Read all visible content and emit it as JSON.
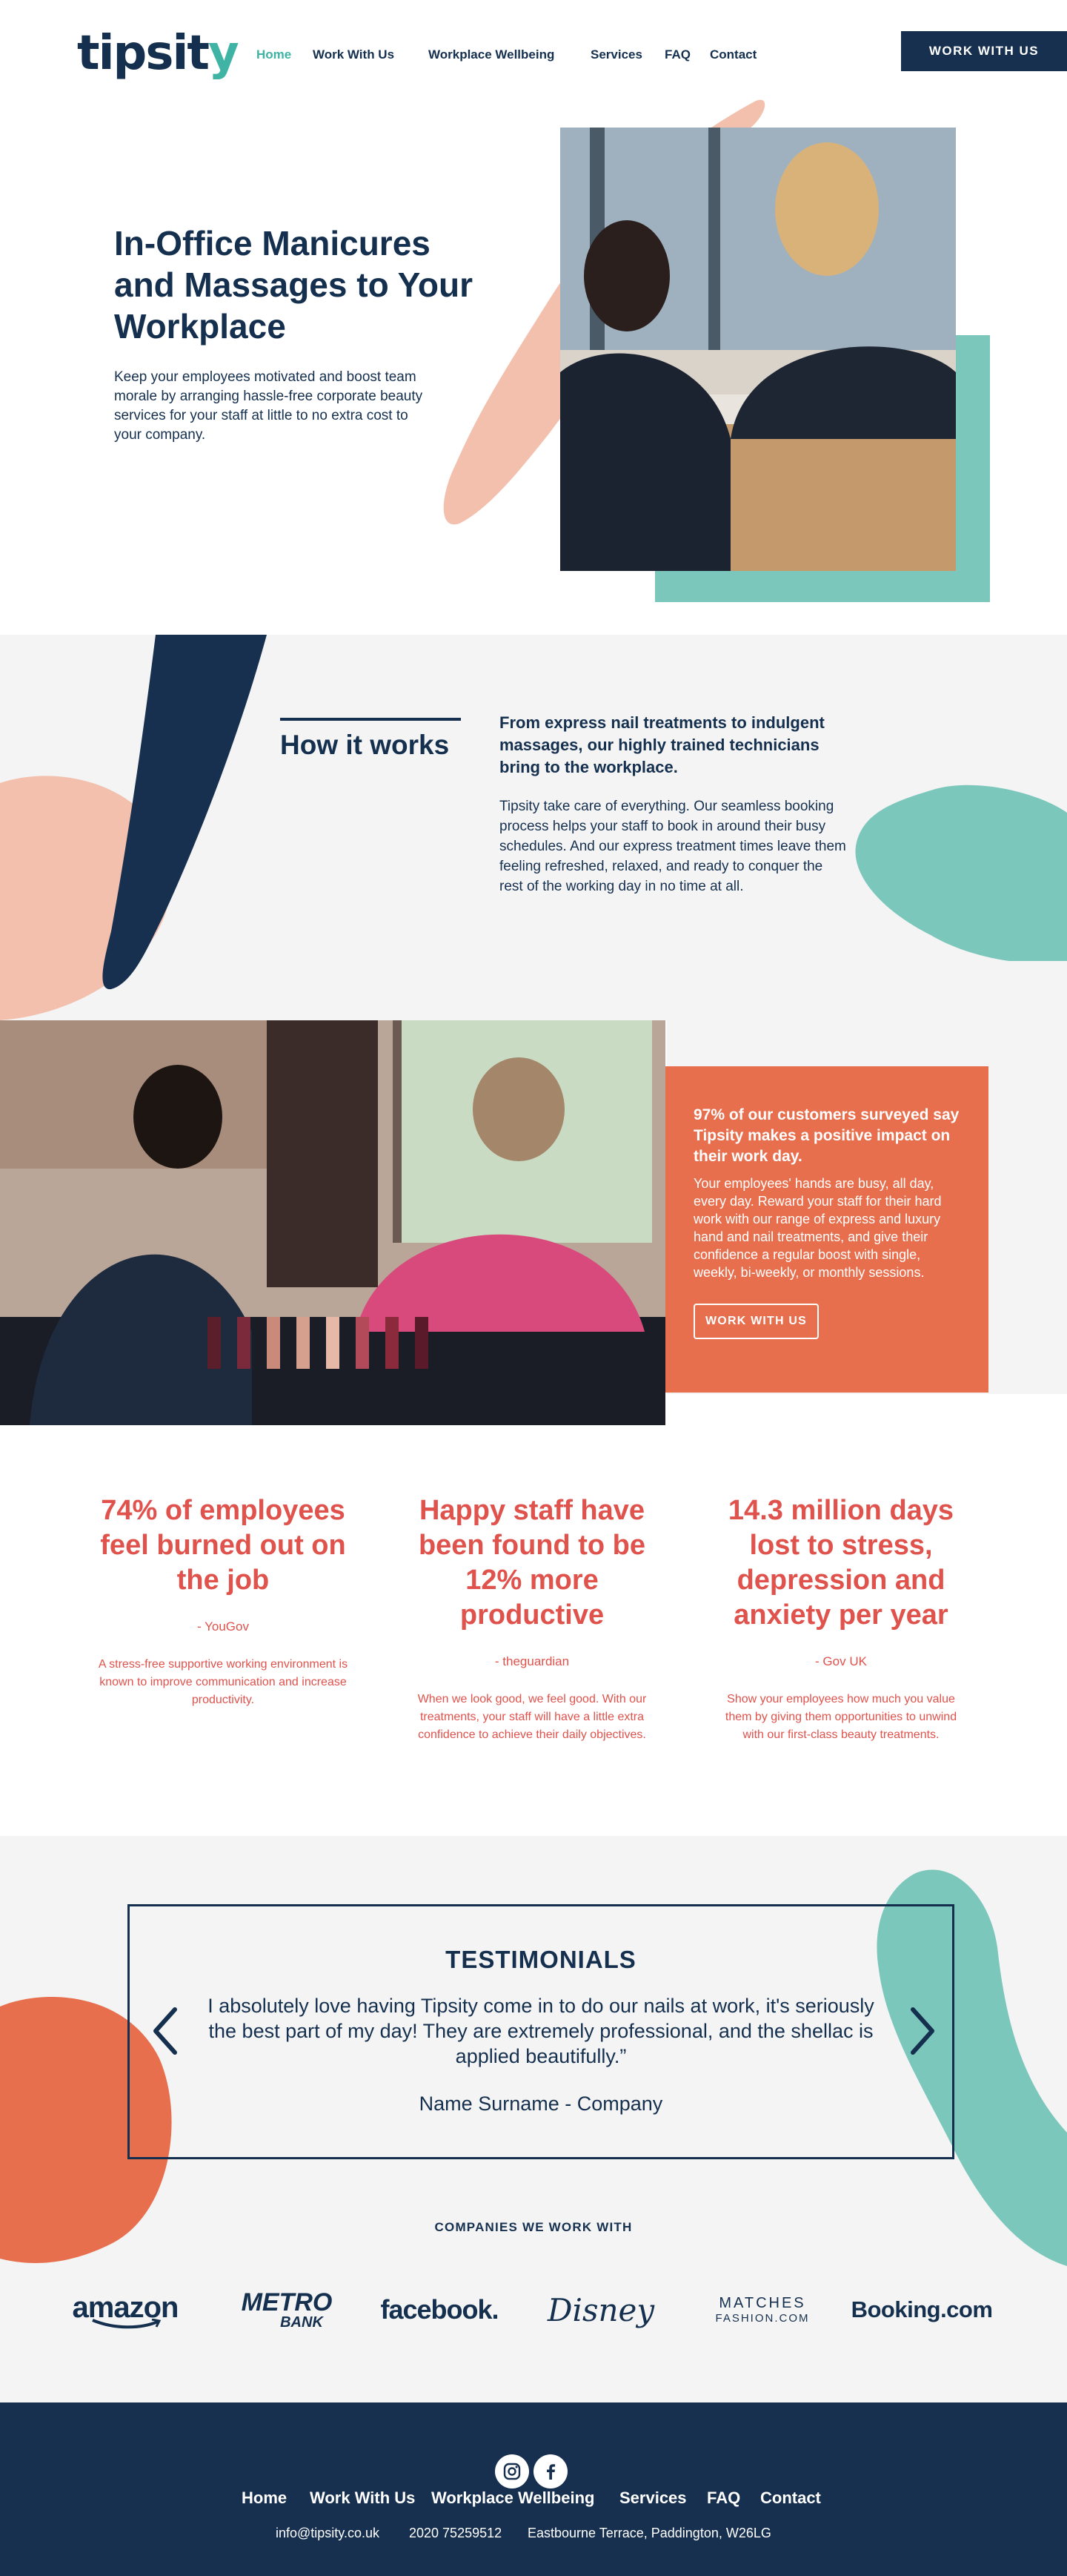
{
  "header": {
    "logo_text_main": "tipsit",
    "logo_text_accent": "y",
    "nav": [
      "Home",
      "Work With Us",
      "Workplace Wellbeing",
      "Services",
      "FAQ",
      "Contact"
    ],
    "cta": "WORK WITH US"
  },
  "hero": {
    "title": "In-Office Manicures and Massages to Your Workplace",
    "text": "Keep your employees motivated and boost team morale by arranging hassle-free corporate beauty services for your staff at little to no extra cost to your company."
  },
  "how": {
    "title": "How it works",
    "lead": "From express nail treatments to indulgent massages, our highly trained technicians bring  to the workplace.",
    "body": "Tipsity take care of everything. Our seamless booking process helps your staff to book in around their busy schedules. And our express treatment times leave them feeling refreshed, relaxed, and ready to conquer the rest of the working day in no time at all."
  },
  "survey": {
    "title": "97% of our customers surveyed say Tipsity makes a positive impact on their work day.",
    "body": "Your employees' hands are busy, all day, every day. Reward your staff for their hard work with our range of express and luxury hand and nail treatments, and give their confidence a regular boost with single, weekly, bi-weekly, or monthly sessions.",
    "button": "WORK WITH US"
  },
  "stats": [
    {
      "title": "74% of employees feel burned out on the job",
      "source": "- YouGov",
      "body": "A stress-free supportive working environment is known to improve communication and increase productivity."
    },
    {
      "title": "Happy staff have been found to be 12% more productive",
      "source": "- theguardian",
      "body": "When we look good, we feel good. With our treatments, your staff will have a little extra confidence to achieve their daily objectives."
    },
    {
      "title": "14.3 million days lost to stress, depression and anxiety per year",
      "source": "- Gov UK",
      "body": "Show your employees how much you value them by giving them opportunities to unwind with our first-class beauty treatments."
    }
  ],
  "testimonials": {
    "title": "TESTIMONIALS",
    "quote": "I absolutely love having Tipsity come in to do our nails at work, it's seriously the best part of my day! They are extremely professional, and the shellac is applied beautifully.”",
    "author": "Name Surname - Company"
  },
  "companies": {
    "title": "COMPANIES WE WORK WITH",
    "brands": [
      "amazon",
      "METRO",
      "BANK",
      "facebook.",
      "Disney",
      "MATCHES",
      "FASHION.COM",
      "Booking.com"
    ]
  },
  "footer": {
    "nav": [
      "Home",
      "Work With Us",
      "Workplace Wellbeing",
      "Services",
      "FAQ",
      "Contact"
    ],
    "email": "info@tipsity.co.uk",
    "phone": "2020 75259512",
    "address": "Eastbourne Terrace, Paddington, W26LG"
  },
  "colors": {
    "navy": "#15304f",
    "teal": "#7bc7bb",
    "peach": "#f3c0ae",
    "coral": "#e86f4d",
    "stat_red": "#e0524c",
    "light_gray": "#f4f4f4"
  },
  "icons": [
    "instagram-icon",
    "facebook-icon",
    "chevron-left-icon",
    "chevron-right-icon"
  ]
}
